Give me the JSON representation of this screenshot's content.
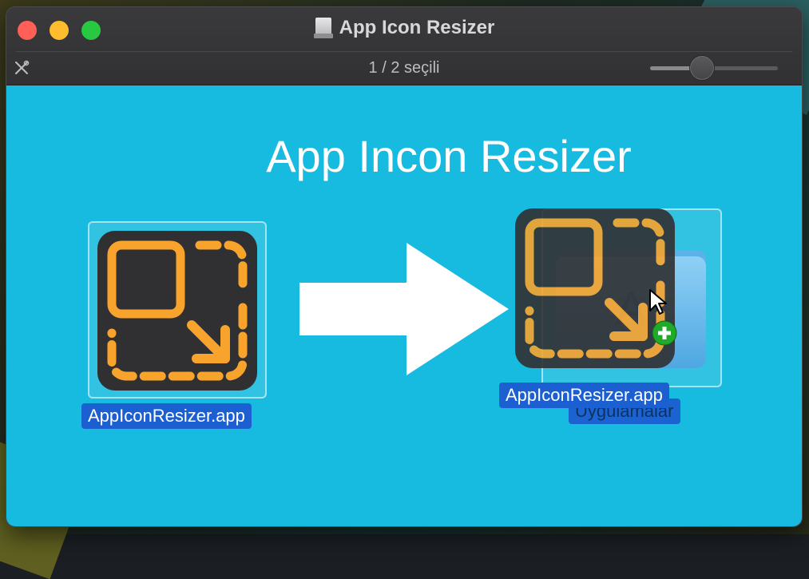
{
  "window": {
    "title": "App Icon Resizer",
    "status": "1 / 2 seçili",
    "icon_size_slider": {
      "value": 0.4
    },
    "icons": {
      "disk": "disk-image-icon",
      "tools": "tools-icon",
      "traffic_lights": [
        "close",
        "minimize",
        "zoom"
      ]
    }
  },
  "content": {
    "background_title": "App Incon Resizer",
    "background_color": "#17bbdf",
    "source_item": {
      "label": "AppIconResizer.app",
      "icon": "app-icon-resizer-icon"
    },
    "drag_ghost": {
      "label": "AppIconResizer.app",
      "icon": "app-icon-resizer-icon",
      "badge": "plus-badge-icon",
      "cursor": "arrow-cursor-icon"
    },
    "target_item": {
      "label": "Uygulamalar",
      "icon": "applications-folder-icon"
    },
    "arrow": "right-arrow-icon"
  },
  "colors": {
    "accent_orange": "#f7a32c",
    "icon_bg": "#303032",
    "selection_blue": "#1b5fd0"
  }
}
